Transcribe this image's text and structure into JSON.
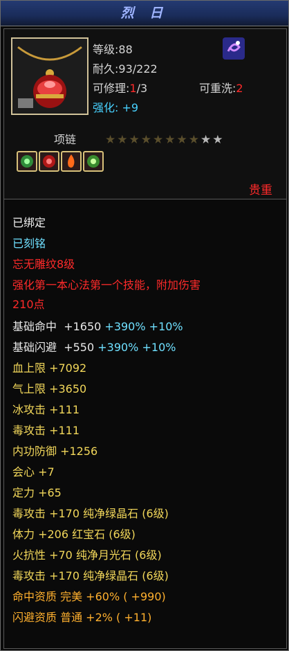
{
  "item": {
    "name": "烈 日",
    "category": "项链",
    "rarity": "贵重",
    "level_label": "等级:",
    "level_value": "88",
    "durability_label": "耐久:",
    "durability_value": "93/222",
    "repair_label": "可修理:",
    "repair_value_red": "1",
    "repair_value_rest": "/3",
    "rewash_label": "可重洗:",
    "rewash_value": "2",
    "enhance_label": "强化:",
    "enhance_value": "+9",
    "stars_filled": 8,
    "stars_total": 10
  },
  "attributes": [
    {
      "text": "已绑定",
      "color": "w"
    },
    {
      "text": "已刻铭",
      "color": "c"
    },
    {
      "text": "忘无雕纹8级",
      "color": "r"
    },
    {
      "text": "强化第一本心法第一个技能，附加伤害",
      "color": "r"
    },
    {
      "text": "210点",
      "color": "r"
    },
    {
      "text": "基础命中",
      "color": "g",
      "v1": "+1650",
      "v2": "+390%",
      "v3": "+10%"
    },
    {
      "text": "基础闪避",
      "color": "g",
      "v1": "+550",
      "v2": "+390%",
      "v3": "+10%"
    },
    {
      "text": "血上限  +7092",
      "color": "y"
    },
    {
      "text": "气上限  +3650",
      "color": "y"
    },
    {
      "text": "冰攻击  +111",
      "color": "y"
    },
    {
      "text": "毒攻击  +111",
      "color": "y"
    },
    {
      "text": "内功防御  +1256",
      "color": "y"
    },
    {
      "text": "会心  +7",
      "color": "y"
    },
    {
      "text": "定力  +65",
      "color": "y"
    },
    {
      "text": "毒攻击  +170  纯净绿晶石 (6级)",
      "color": "y"
    },
    {
      "text": "体力  +206  红宝石 (6级)",
      "color": "y"
    },
    {
      "text": "火抗性  +70  纯净月光石 (6级)",
      "color": "y"
    },
    {
      "text": "毒攻击  +170  纯净绿晶石 (6级)",
      "color": "y"
    },
    {
      "text": "命中资质    完美  +60% ( +990)",
      "color": "o"
    },
    {
      "text": "闪避资质    普通  +2% ( +11)",
      "color": "o"
    }
  ]
}
